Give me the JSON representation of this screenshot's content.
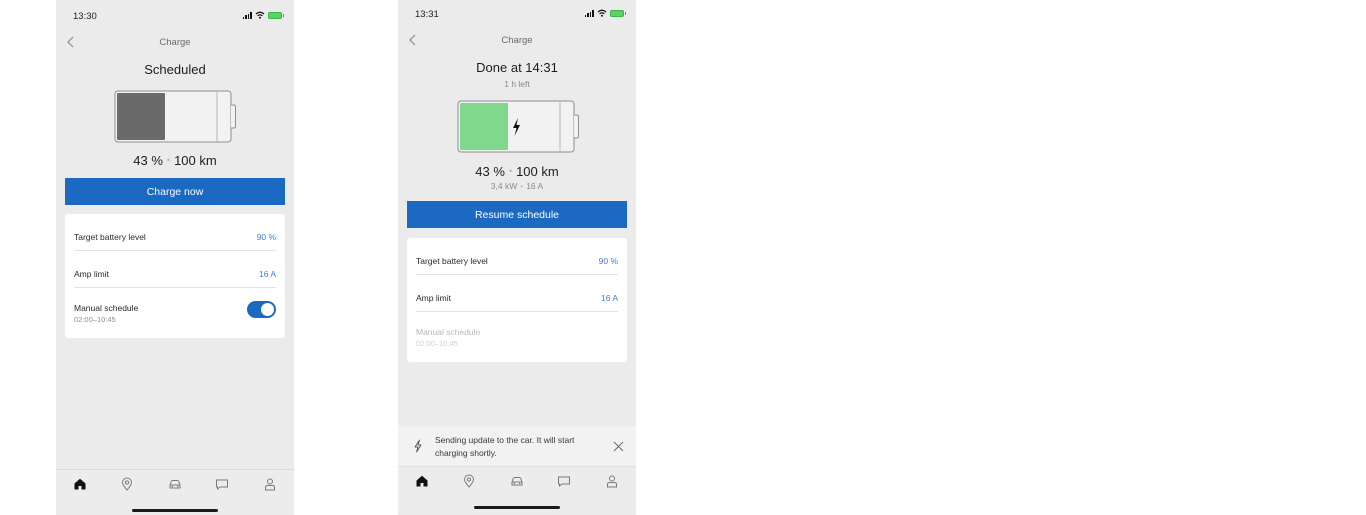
{
  "screens": [
    {
      "status_time": "13:30",
      "nav_title": "Charge",
      "headline": "Scheduled",
      "battery_state": "idle",
      "battery_level_fraction": 0.43,
      "battery_fill_color": "#6a6a6a",
      "percent": "43 %",
      "range": "100 km",
      "primary_button": "Charge now",
      "settings": {
        "target_label": "Target battery level",
        "target_value": "90 %",
        "amp_label": "Amp limit",
        "amp_value": "16 A",
        "schedule_label": "Manual schedule",
        "schedule_time": "02:00–10:45",
        "schedule_toggle_on": true
      },
      "tabs": [
        "home-icon",
        "location-pin-icon",
        "car-icon",
        "chat-icon",
        "profile-icon"
      ]
    },
    {
      "status_time": "13:31",
      "nav_title": "Charge",
      "headline": "Done at 14:31",
      "subline": "1 h left",
      "battery_state": "charging",
      "battery_level_fraction": 0.43,
      "battery_fill_color": "#7fd88c",
      "percent": "43 %",
      "range": "100 km",
      "power": "3,4 kW",
      "current": "16 A",
      "primary_button": "Resume schedule",
      "settings": {
        "target_label": "Target battery level",
        "target_value": "90 %",
        "amp_label": "Amp limit",
        "amp_value": "16 A",
        "schedule_label": "Manual schedule",
        "schedule_time": "02:00–10:45",
        "schedule_disabled": true
      },
      "toast": {
        "message": "Sending update to the car. It will start charging shortly."
      },
      "tabs": [
        "home-icon",
        "location-pin-icon",
        "car-icon",
        "chat-icon",
        "profile-icon"
      ]
    }
  ],
  "colors": {
    "accent": "#1c69c1",
    "value_text": "#3f7fd0",
    "background": "#ebebeb"
  }
}
